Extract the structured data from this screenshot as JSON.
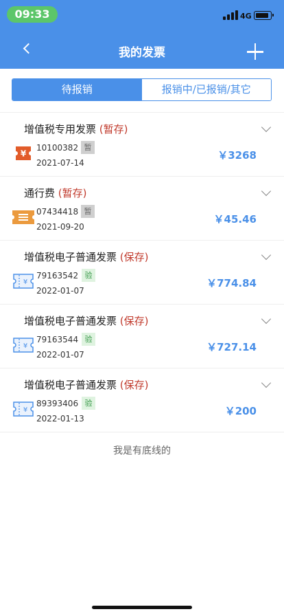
{
  "status_bar": {
    "time": "09:33",
    "network": "4G"
  },
  "header": {
    "title": "我的发票"
  },
  "tabs": [
    {
      "label": "待报销",
      "active": true
    },
    {
      "label": "报销中/已报销/其它",
      "active": false
    }
  ],
  "invoices": [
    {
      "title": "增值税专用发票",
      "status": "(暂存)",
      "number": "10100382",
      "badge": "暂",
      "date": "2021-07-14",
      "amount": "￥3268",
      "icon": "yen-ticket-icon"
    },
    {
      "title": "通行费",
      "status": "(暂存)",
      "number": "07434418",
      "badge": "暂",
      "date": "2021-09-20",
      "amount": "￥45.46",
      "icon": "toll-ticket-icon"
    },
    {
      "title": "增值税电子普通发票",
      "status": "(保存)",
      "number": "79163542",
      "badge": "验",
      "date": "2022-01-07",
      "amount": "￥774.84",
      "icon": "e-invoice-icon"
    },
    {
      "title": "增值税电子普通发票",
      "status": "(保存)",
      "number": "79163544",
      "badge": "验",
      "date": "2022-01-07",
      "amount": "￥727.14",
      "icon": "e-invoice-icon"
    },
    {
      "title": "增值税电子普通发票",
      "status": "(保存)",
      "number": "89393406",
      "badge": "验",
      "date": "2022-01-13",
      "amount": "￥200",
      "icon": "e-invoice-icon"
    }
  ],
  "footer": {
    "text": "我是有底线的"
  },
  "colors": {
    "primary": "#4a90e8",
    "status_red": "#c0392b",
    "time_pill": "#5cc66a"
  }
}
